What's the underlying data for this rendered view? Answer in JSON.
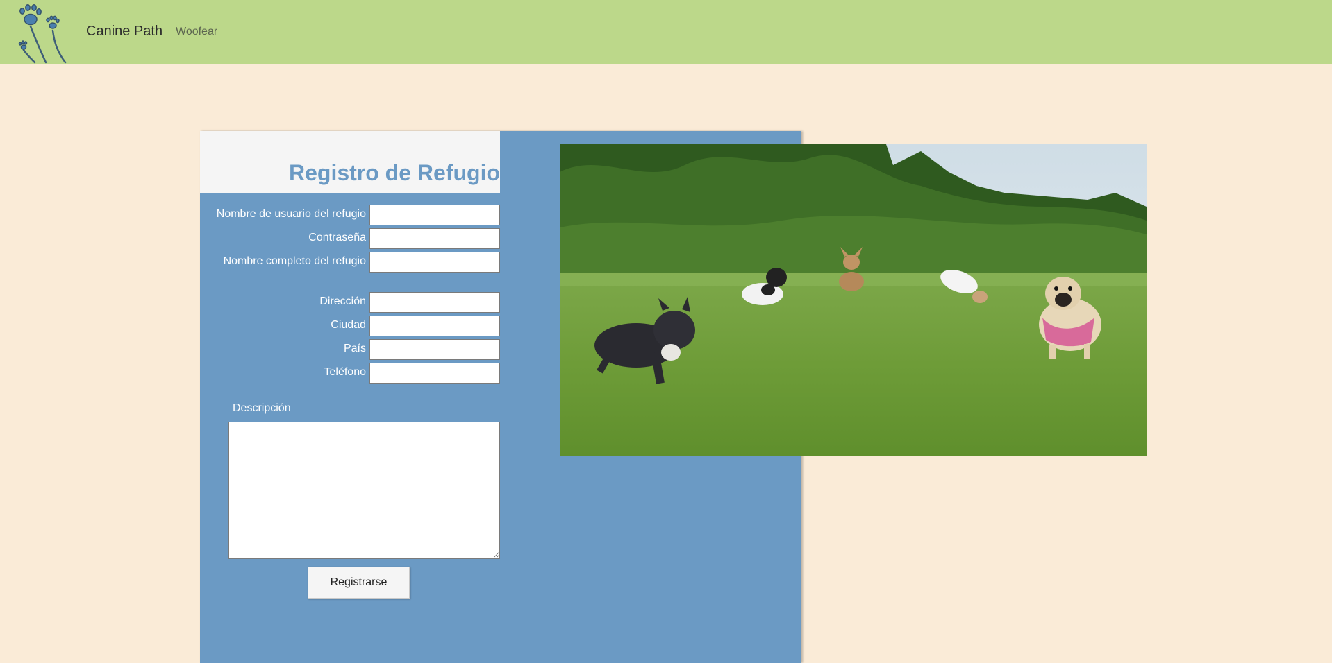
{
  "navbar": {
    "brand": "Canine Path",
    "links": [
      "Woofear"
    ],
    "logo_icon": "paw-flower-logo",
    "background": "#bcd88a"
  },
  "form": {
    "title": "Registro de Refugio",
    "fields": [
      {
        "label": "Nombre de usuario del refugio",
        "value": "",
        "placeholder": ""
      },
      {
        "label": "Contraseña",
        "value": "",
        "placeholder": ""
      },
      {
        "label": "Nombre completo del refugio",
        "value": "",
        "placeholder": ""
      },
      {
        "label": "Dirección",
        "value": "",
        "placeholder": ""
      },
      {
        "label": "Ciudad",
        "value": "",
        "placeholder": ""
      },
      {
        "label": "País",
        "value": "",
        "placeholder": ""
      },
      {
        "label": "Teléfono",
        "value": "",
        "placeholder": ""
      }
    ],
    "description_label": "Descripción",
    "description_value": "",
    "submit_label": "Registrarse",
    "panel_color": "#6b9ac4",
    "title_color": "#6b9ac4"
  },
  "photo": {
    "subject": "dogs-running-in-park-photo"
  },
  "page": {
    "background": "#faebd7"
  }
}
